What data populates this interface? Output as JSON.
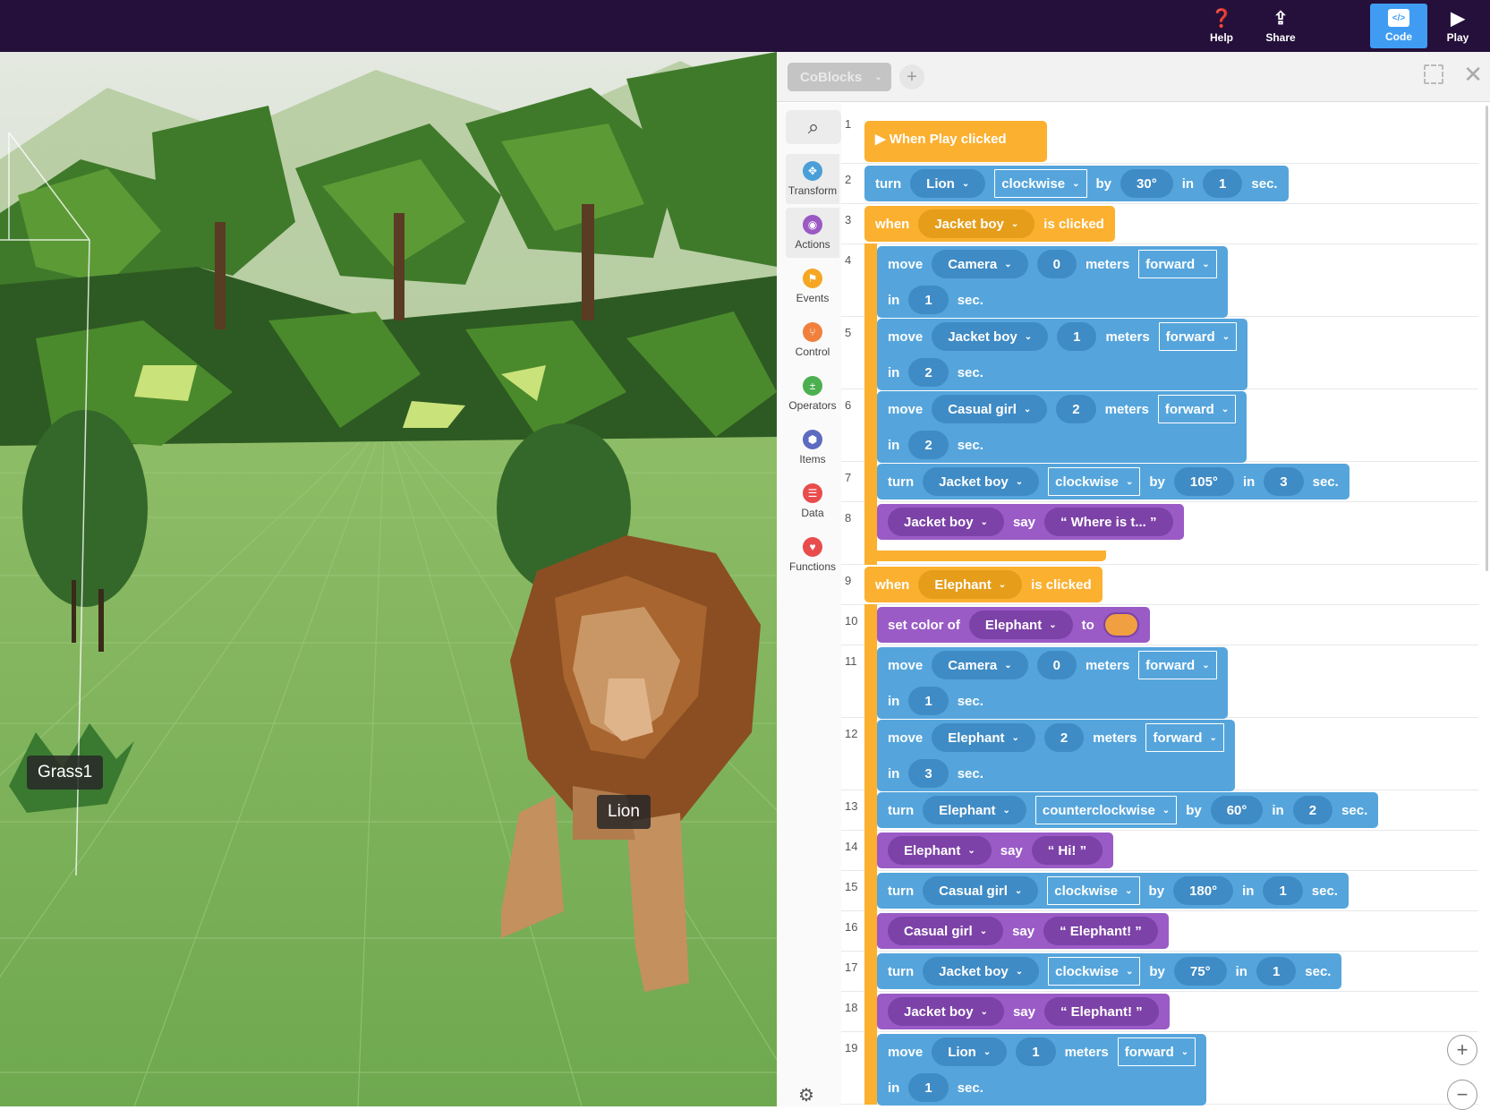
{
  "topbar": {
    "help": "Help",
    "share": "Share",
    "code": "Code",
    "play": "Play",
    "accent": "#3f9cf2"
  },
  "scene": {
    "labels": {
      "grass": "Grass1",
      "lion": "Lion"
    }
  },
  "panel": {
    "project": "CoBlocks",
    "add": "+",
    "close": "✕"
  },
  "categories": [
    {
      "label": "Transform",
      "color": "#4a9fd8",
      "icon": "✥"
    },
    {
      "label": "Actions",
      "color": "#9b59c4",
      "icon": "◉"
    },
    {
      "label": "Events",
      "color": "#f5a623",
      "icon": "⚑"
    },
    {
      "label": "Control",
      "color": "#f0803c",
      "icon": "⑂"
    },
    {
      "label": "Operators",
      "color": "#4caf50",
      "icon": "±"
    },
    {
      "label": "Items",
      "color": "#5c6bc0",
      "icon": "⬢"
    },
    {
      "label": "Data",
      "color": "#e84c4c",
      "icon": "☰"
    },
    {
      "label": "Functions",
      "color": "#e84c4c",
      "icon": "♥"
    }
  ],
  "code": {
    "lines": [
      {
        "num": "1",
        "color": "orange",
        "indent": 0,
        "hat": true,
        "rows": [
          [
            {
              "t": "text",
              "v": "▶ When Play clicked"
            }
          ]
        ]
      },
      {
        "num": "2",
        "color": "blue",
        "indent": 0,
        "rows": [
          [
            {
              "t": "text",
              "v": "turn"
            },
            {
              "t": "drop",
              "v": "Lion"
            },
            {
              "t": "box",
              "v": "clockwise"
            },
            {
              "t": "text",
              "v": "by"
            },
            {
              "t": "num",
              "v": "30°"
            },
            {
              "t": "text",
              "v": "in"
            },
            {
              "t": "num",
              "v": "1"
            },
            {
              "t": "text",
              "v": "sec."
            }
          ]
        ]
      },
      {
        "num": "3",
        "color": "orange",
        "indent": 0,
        "rows": [
          [
            {
              "t": "text",
              "v": "when"
            },
            {
              "t": "drop",
              "v": "Jacket boy"
            },
            {
              "t": "text",
              "v": "is clicked"
            }
          ]
        ]
      },
      {
        "num": "4",
        "color": "blue",
        "indent": 1,
        "rows": [
          [
            {
              "t": "text",
              "v": "move"
            },
            {
              "t": "drop",
              "v": "Camera"
            },
            {
              "t": "num",
              "v": "0"
            },
            {
              "t": "text",
              "v": "meters"
            },
            {
              "t": "box",
              "v": "forward"
            }
          ],
          [
            {
              "t": "text",
              "v": "in"
            },
            {
              "t": "num",
              "v": "1"
            },
            {
              "t": "text",
              "v": "sec."
            }
          ]
        ]
      },
      {
        "num": "5",
        "color": "blue",
        "indent": 1,
        "rows": [
          [
            {
              "t": "text",
              "v": "move"
            },
            {
              "t": "drop",
              "v": "Jacket boy"
            },
            {
              "t": "num",
              "v": "1"
            },
            {
              "t": "text",
              "v": "meters"
            },
            {
              "t": "box",
              "v": "forward"
            }
          ],
          [
            {
              "t": "text",
              "v": "in"
            },
            {
              "t": "num",
              "v": "2"
            },
            {
              "t": "text",
              "v": "sec."
            }
          ]
        ]
      },
      {
        "num": "6",
        "color": "blue",
        "indent": 1,
        "rows": [
          [
            {
              "t": "text",
              "v": "move"
            },
            {
              "t": "drop",
              "v": "Casual girl"
            },
            {
              "t": "num",
              "v": "2"
            },
            {
              "t": "text",
              "v": "meters"
            },
            {
              "t": "box",
              "v": "forward"
            }
          ],
          [
            {
              "t": "text",
              "v": "in"
            },
            {
              "t": "num",
              "v": "2"
            },
            {
              "t": "text",
              "v": "sec."
            }
          ]
        ]
      },
      {
        "num": "7",
        "color": "blue",
        "indent": 1,
        "rows": [
          [
            {
              "t": "text",
              "v": "turn"
            },
            {
              "t": "drop",
              "v": "Jacket boy"
            },
            {
              "t": "box",
              "v": "clockwise"
            },
            {
              "t": "text",
              "v": "by"
            },
            {
              "t": "num",
              "v": "105°"
            },
            {
              "t": "text",
              "v": "in"
            },
            {
              "t": "num",
              "v": "3"
            },
            {
              "t": "text",
              "v": "sec."
            }
          ]
        ]
      },
      {
        "num": "8",
        "color": "purple",
        "indent": 1,
        "closes": true,
        "rows": [
          [
            {
              "t": "drop",
              "v": "Jacket boy"
            },
            {
              "t": "text",
              "v": "say"
            },
            {
              "t": "num",
              "v": "“  Where is t...    ”"
            }
          ]
        ]
      },
      {
        "num": "9",
        "color": "orange",
        "indent": 0,
        "rows": [
          [
            {
              "t": "text",
              "v": "when"
            },
            {
              "t": "drop",
              "v": "Elephant"
            },
            {
              "t": "text",
              "v": "is clicked"
            }
          ]
        ]
      },
      {
        "num": "10",
        "color": "purple",
        "indent": 1,
        "rows": [
          [
            {
              "t": "text",
              "v": "set color of"
            },
            {
              "t": "drop",
              "v": "Elephant"
            },
            {
              "t": "text",
              "v": "to"
            },
            {
              "t": "swatch",
              "v": "#f0a040"
            }
          ]
        ]
      },
      {
        "num": "11",
        "color": "blue",
        "indent": 1,
        "rows": [
          [
            {
              "t": "text",
              "v": "move"
            },
            {
              "t": "drop",
              "v": "Camera"
            },
            {
              "t": "num",
              "v": "0"
            },
            {
              "t": "text",
              "v": "meters"
            },
            {
              "t": "box",
              "v": "forward"
            }
          ],
          [
            {
              "t": "text",
              "v": "in"
            },
            {
              "t": "num",
              "v": "1"
            },
            {
              "t": "text",
              "v": "sec."
            }
          ]
        ]
      },
      {
        "num": "12",
        "color": "blue",
        "indent": 1,
        "rows": [
          [
            {
              "t": "text",
              "v": "move"
            },
            {
              "t": "drop",
              "v": "Elephant"
            },
            {
              "t": "num",
              "v": "2"
            },
            {
              "t": "text",
              "v": "meters"
            },
            {
              "t": "box",
              "v": "forward"
            }
          ],
          [
            {
              "t": "text",
              "v": "in"
            },
            {
              "t": "num",
              "v": "3"
            },
            {
              "t": "text",
              "v": "sec."
            }
          ]
        ]
      },
      {
        "num": "13",
        "color": "blue",
        "indent": 1,
        "rows": [
          [
            {
              "t": "text",
              "v": "turn"
            },
            {
              "t": "drop",
              "v": "Elephant"
            },
            {
              "t": "box",
              "v": "counterclockwise"
            },
            {
              "t": "text",
              "v": "by"
            },
            {
              "t": "num",
              "v": "60°"
            },
            {
              "t": "text",
              "v": "in"
            },
            {
              "t": "num",
              "v": "2"
            },
            {
              "t": "text",
              "v": "sec."
            }
          ]
        ]
      },
      {
        "num": "14",
        "color": "purple",
        "indent": 1,
        "rows": [
          [
            {
              "t": "drop",
              "v": "Elephant"
            },
            {
              "t": "text",
              "v": "say"
            },
            {
              "t": "num",
              "v": "“  Hi!  ”"
            }
          ]
        ]
      },
      {
        "num": "15",
        "color": "blue",
        "indent": 1,
        "rows": [
          [
            {
              "t": "text",
              "v": "turn"
            },
            {
              "t": "drop",
              "v": "Casual girl"
            },
            {
              "t": "box",
              "v": "clockwise"
            },
            {
              "t": "text",
              "v": "by"
            },
            {
              "t": "num",
              "v": "180°"
            },
            {
              "t": "text",
              "v": "in"
            },
            {
              "t": "num",
              "v": "1"
            },
            {
              "t": "text",
              "v": "sec."
            }
          ]
        ]
      },
      {
        "num": "16",
        "color": "purple",
        "indent": 1,
        "rows": [
          [
            {
              "t": "drop",
              "v": "Casual girl"
            },
            {
              "t": "text",
              "v": "say"
            },
            {
              "t": "num",
              "v": "“  Elephant!  ”"
            }
          ]
        ]
      },
      {
        "num": "17",
        "color": "blue",
        "indent": 1,
        "rows": [
          [
            {
              "t": "text",
              "v": "turn"
            },
            {
              "t": "drop",
              "v": "Jacket boy"
            },
            {
              "t": "box",
              "v": "clockwise"
            },
            {
              "t": "text",
              "v": "by"
            },
            {
              "t": "num",
              "v": "75°"
            },
            {
              "t": "text",
              "v": "in"
            },
            {
              "t": "num",
              "v": "1"
            },
            {
              "t": "text",
              "v": "sec."
            }
          ]
        ]
      },
      {
        "num": "18",
        "color": "purple",
        "indent": 1,
        "rows": [
          [
            {
              "t": "drop",
              "v": "Jacket boy"
            },
            {
              "t": "text",
              "v": "say"
            },
            {
              "t": "num",
              "v": "“  Elephant!  ”"
            }
          ]
        ]
      },
      {
        "num": "19",
        "color": "blue",
        "indent": 1,
        "rows": [
          [
            {
              "t": "text",
              "v": "move"
            },
            {
              "t": "drop",
              "v": "Lion"
            },
            {
              "t": "num",
              "v": "1"
            },
            {
              "t": "text",
              "v": "meters"
            },
            {
              "t": "box",
              "v": "forward"
            }
          ],
          [
            {
              "t": "text",
              "v": "in"
            },
            {
              "t": "num",
              "v": "1"
            },
            {
              "t": "text",
              "v": "sec."
            }
          ]
        ]
      }
    ]
  },
  "zoom": {
    "in": "+",
    "out": "−"
  }
}
